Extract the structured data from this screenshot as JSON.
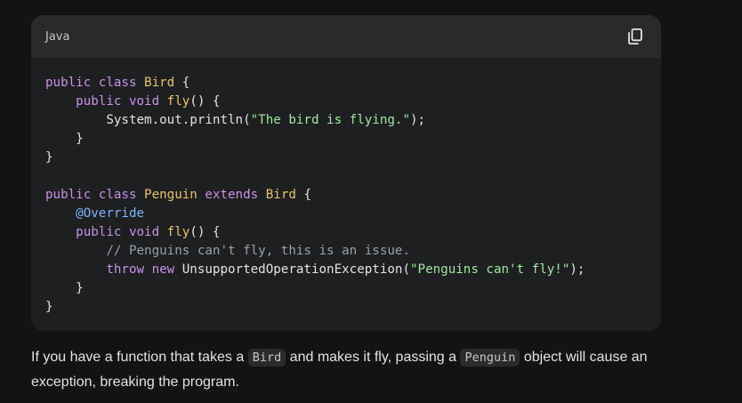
{
  "code_block": {
    "language": "Java",
    "copy_icon": "copy-icon",
    "lines": [
      [
        {
          "t": "kw",
          "v": "public class "
        },
        {
          "t": "cls",
          "v": "Bird"
        },
        {
          "t": "pun",
          "v": " {"
        }
      ],
      [
        {
          "t": "pun",
          "v": "    "
        },
        {
          "t": "kw",
          "v": "public void "
        },
        {
          "t": "fn",
          "v": "fly"
        },
        {
          "t": "pun",
          "v": "() {"
        }
      ],
      [
        {
          "t": "pun",
          "v": "        System.out.println("
        },
        {
          "t": "str",
          "v": "\"The bird is flying.\""
        },
        {
          "t": "pun",
          "v": ");"
        }
      ],
      [
        {
          "t": "pun",
          "v": "    }"
        }
      ],
      [
        {
          "t": "pun",
          "v": "}"
        }
      ],
      [
        {
          "t": "pun",
          "v": ""
        }
      ],
      [
        {
          "t": "kw",
          "v": "public class "
        },
        {
          "t": "cls",
          "v": "Penguin "
        },
        {
          "t": "kw",
          "v": "extends "
        },
        {
          "t": "cls",
          "v": "Bird"
        },
        {
          "t": "pun",
          "v": " {"
        }
      ],
      [
        {
          "t": "pun",
          "v": "    "
        },
        {
          "t": "ann",
          "v": "@Override"
        }
      ],
      [
        {
          "t": "pun",
          "v": "    "
        },
        {
          "t": "kw",
          "v": "public void "
        },
        {
          "t": "fn",
          "v": "fly"
        },
        {
          "t": "pun",
          "v": "() {"
        }
      ],
      [
        {
          "t": "pun",
          "v": "        "
        },
        {
          "t": "cmt",
          "v": "// Penguins can't fly, this is an issue."
        }
      ],
      [
        {
          "t": "pun",
          "v": "        "
        },
        {
          "t": "kw",
          "v": "throw new "
        },
        {
          "t": "pun",
          "v": "UnsupportedOperationException("
        },
        {
          "t": "str",
          "v": "\"Penguins can't fly!\""
        },
        {
          "t": "pun",
          "v": ");"
        }
      ],
      [
        {
          "t": "pun",
          "v": "    }"
        }
      ],
      [
        {
          "t": "pun",
          "v": "}"
        }
      ]
    ]
  },
  "prose": {
    "part1": "If you have a function that takes a ",
    "code1": "Bird",
    "part2": " and makes it fly, passing a ",
    "code2": "Penguin",
    "part3": " object will cause an exception, breaking the program."
  }
}
